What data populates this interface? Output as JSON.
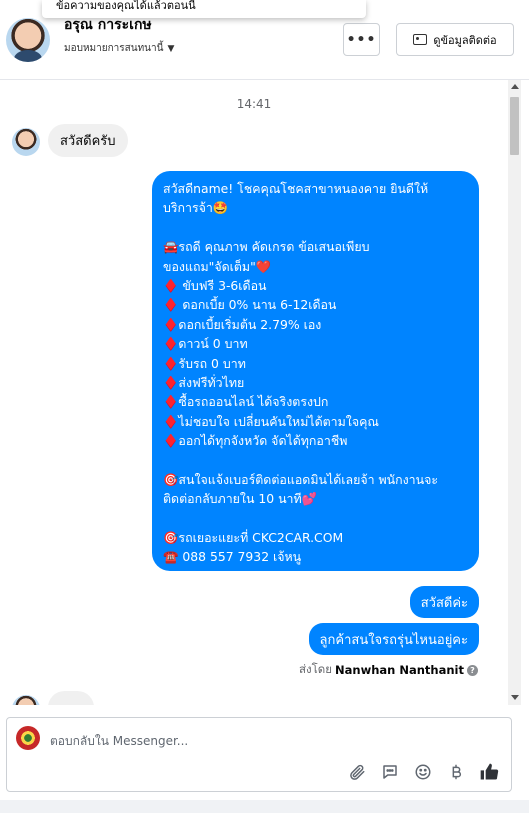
{
  "header": {
    "tooltip": "ข้อความของคุณได้แล้วตอนนี้",
    "contact_name": "อรุณ การะเกษ",
    "assign_label": "มอบหมายการสนทนานี้",
    "more_label": "•••",
    "contact_info_label": "ดูข้อมูลติดต่อ"
  },
  "chat": {
    "timestamp": "14:41",
    "incoming_greeting": "สวัสดีครับ",
    "big_message_lines": [
      "สวัสดีname! โชคคุณโชคสาขาหนองคาย ยินดีให้",
      "บริการจ้า🤩",
      "",
      "🚘รถดี คุณภาพ คัดเกรด ข้อเสนอเพียบ",
      "ของแถม\"จัดเต็ม\"❤️",
      "♦️ ขับฟรี 3-6เดือน",
      "♦️ ดอกเบี้ย 0% นาน 6-12เดือน",
      "♦️ดอกเบี้ยเริ่มต้น 2.79% เอง",
      "♦️ดาวน์ 0 บาท",
      "♦️รับรถ 0 บาท",
      "♦️ส่งฟรีทั่วไทย",
      "♦️ซื้อรถออนไลน์ ได้จริงตรงปก",
      "♦️ไม่ชอบใจ เปลี่ยนคันใหม่ได้ตามใจคุณ",
      "♦️ออกได้ทุกจังหวัด จัดได้ทุกอาชีพ",
      "",
      "🎯สนใจแจ้งเบอร์ติดต่อแอดมินได้เลยจ้า พนักงานจะ",
      "ติดต่อกลับภายใน 10 นาที💕",
      "",
      "🎯รถเยอะแยะที่ CKC2CAR.COM",
      "☎️ 088 557 7932 เจ้หนู"
    ],
    "outgoing_hello": "สวัสดีค่ะ",
    "outgoing_question": "ลูกค้าสนใจรถรุ่นไหนอยู่คะ",
    "sent_by_prefix": "ส่งโดย",
    "sent_by_name": "Nanwhan Nanthanit",
    "help_glyph": "?"
  },
  "composer": {
    "placeholder": "ตอบกลับใน Messenger...",
    "value": ""
  },
  "icons": {
    "attach": "paperclip-icon",
    "saved_replies": "chat-bubble-icon",
    "emoji": "smile-icon",
    "payment": "baht-icon",
    "like": "thumbs-up-icon"
  },
  "colors": {
    "outgoing_bubble": "#0084ff",
    "incoming_bubble": "#f0f0f0"
  }
}
